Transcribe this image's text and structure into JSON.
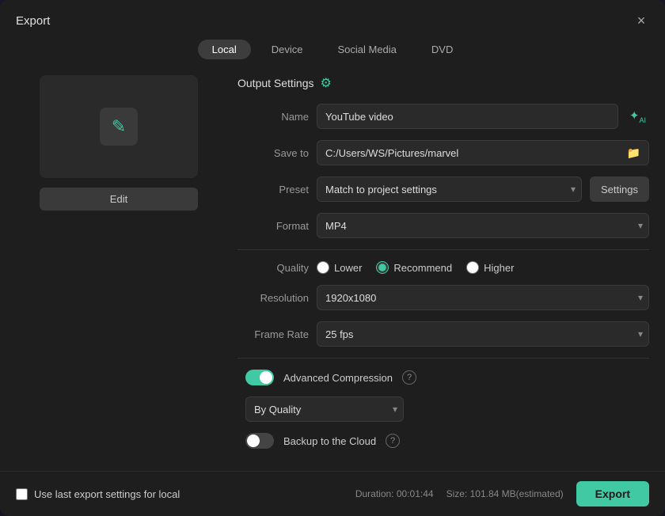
{
  "dialog": {
    "title": "Export",
    "close_label": "×"
  },
  "tabs": [
    {
      "label": "Local",
      "active": true
    },
    {
      "label": "Device",
      "active": false
    },
    {
      "label": "Social Media",
      "active": false
    },
    {
      "label": "DVD",
      "active": false
    }
  ],
  "preview": {
    "edit_label": "Edit"
  },
  "output_settings": {
    "header": "Output Settings",
    "name_label": "Name",
    "name_value": "YouTube video",
    "save_to_label": "Save to",
    "save_to_value": "C:/Users/WS/Pictures/marvel",
    "preset_label": "Preset",
    "preset_value": "Match to project settings",
    "settings_label": "Settings",
    "format_label": "Format",
    "format_value": "MP4",
    "quality_label": "Quality",
    "quality_options": [
      {
        "label": "Lower",
        "value": "lower"
      },
      {
        "label": "Recommend",
        "value": "recommend",
        "selected": true
      },
      {
        "label": "Higher",
        "value": "higher"
      }
    ],
    "resolution_label": "Resolution",
    "resolution_value": "1920x1080",
    "frame_rate_label": "Frame Rate",
    "frame_rate_value": "25 fps",
    "advanced_compression_label": "Advanced Compression",
    "advanced_compression_on": true,
    "by_quality_label": "By Quality",
    "backup_cloud_label": "Backup to the Cloud",
    "backup_cloud_on": false
  },
  "footer": {
    "use_last_label": "Use last export settings for local",
    "duration_label": "Duration: 00:01:44",
    "size_label": "Size: 101.84 MB(estimated)",
    "export_label": "Export"
  }
}
